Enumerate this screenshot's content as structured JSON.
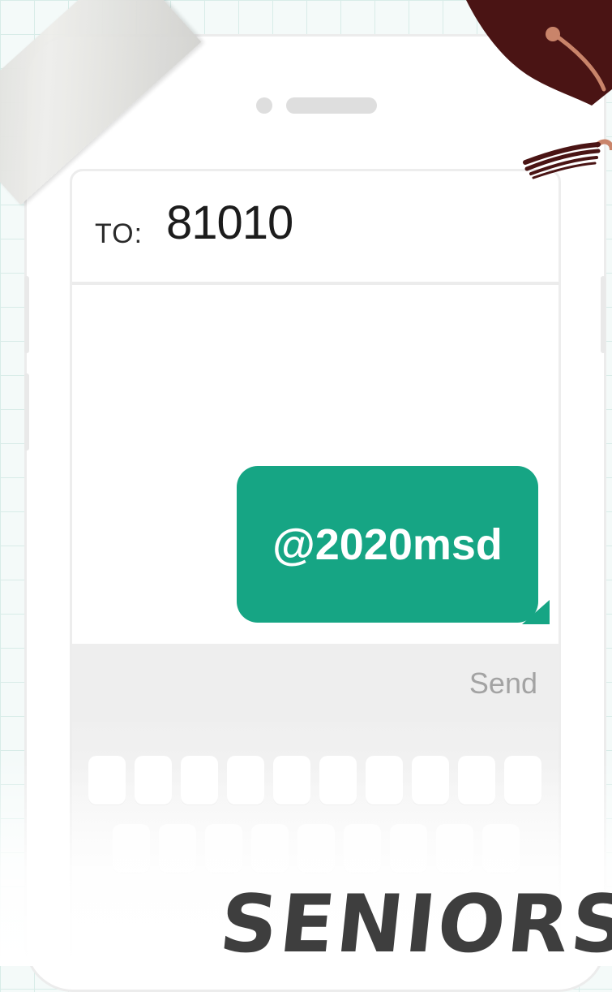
{
  "phone": {
    "recipient_label": "TO:",
    "recipient_number": "81010",
    "message": "@2020msd",
    "send_label": "Send"
  },
  "caption": "SENIORS",
  "colors": {
    "bubble": "#16a584",
    "cap": "#4a1414",
    "tassel": "#c9846a",
    "caption": "#3e3e3e"
  },
  "icons": [
    "graduation-cap-icon",
    "tape-decoration"
  ]
}
